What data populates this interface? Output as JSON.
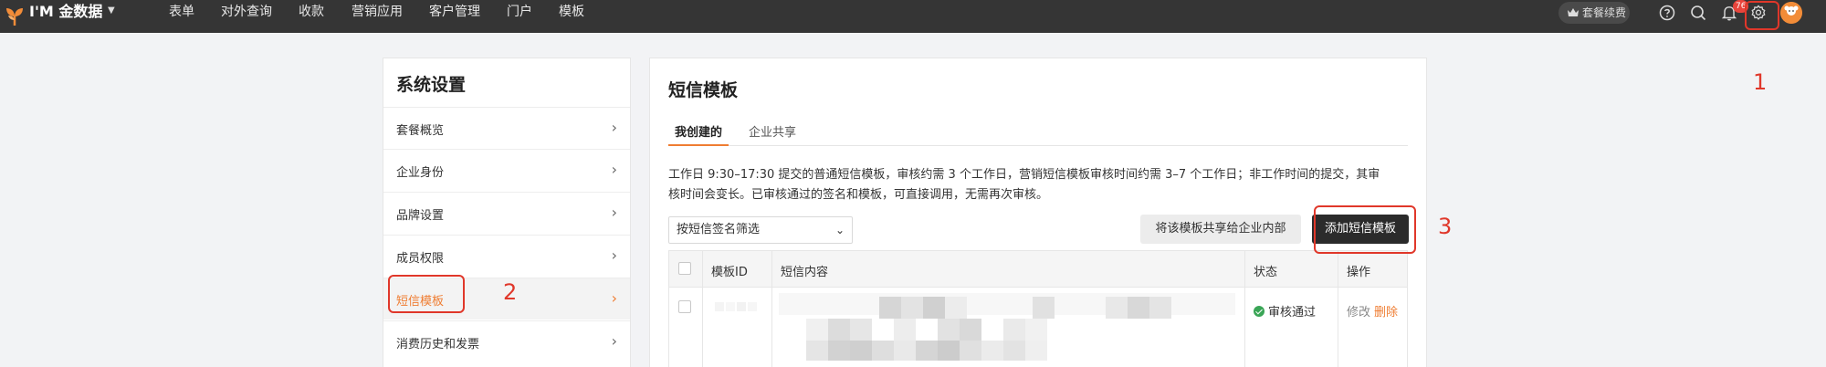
{
  "header": {
    "brand": "I'M 金数据",
    "nav": [
      "表单",
      "对外查询",
      "收款",
      "营销应用",
      "客户管理",
      "门户",
      "模板"
    ],
    "upgrade_label": "套餐续费",
    "notification_count": "76",
    "icons": [
      "help-icon",
      "search-icon",
      "bell-icon",
      "gear-icon"
    ]
  },
  "sidebar": {
    "title": "系统设置",
    "items": [
      {
        "label": "套餐概览"
      },
      {
        "label": "企业身份"
      },
      {
        "label": "品牌设置"
      },
      {
        "label": "成员权限"
      },
      {
        "label": "短信模板",
        "active": true
      },
      {
        "label": "消费历史和发票"
      }
    ]
  },
  "main": {
    "title": "短信模板",
    "tabs": [
      {
        "label": "我创建的",
        "active": true
      },
      {
        "label": "企业共享"
      }
    ],
    "notice_line1": "工作日 9:30–17:30 提交的普通短信模板，审核约需 3 个工作日，营销短信模板审核时间约需 3–7 个工作日；非工作时间的提交，其审",
    "notice_line2": "核时间会变长。已审核通过的签名和模板，可直接调用，无需再次审核。",
    "filter_placeholder": "按短信签名筛选",
    "share_button": "将该模板共享给企业内部",
    "add_button": "添加短信模板",
    "table": {
      "columns": [
        "模板ID",
        "短信内容",
        "状态",
        "操作"
      ],
      "rows": [
        {
          "status": "审核通过",
          "edit": "修改",
          "delete": "删除"
        }
      ]
    }
  },
  "annotations": {
    "labels": [
      "1",
      "2",
      "3"
    ],
    "color": "#e0372a"
  },
  "colors": {
    "accent": "#ef7d32",
    "topbar": "#353535",
    "success": "#3aa556"
  }
}
